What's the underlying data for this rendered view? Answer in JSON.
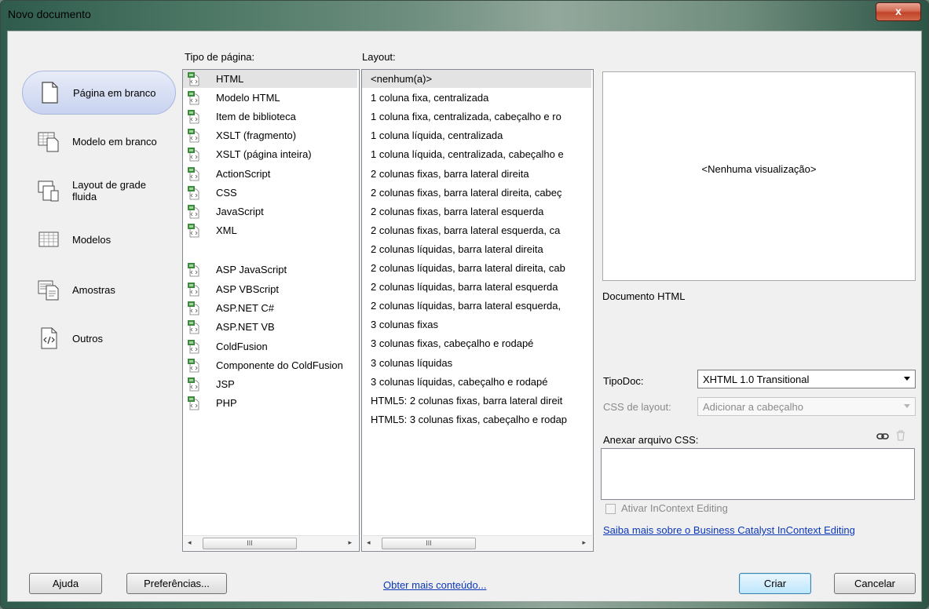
{
  "window": {
    "title": "Novo documento",
    "close_label": "x"
  },
  "nav": [
    {
      "label": "Página em branco",
      "icon": "blank-page-icon",
      "selected": true
    },
    {
      "label": "Modelo em branco",
      "icon": "blank-template-icon"
    },
    {
      "label": "Layout de grade fluida",
      "icon": "fluid-grid-icon"
    },
    {
      "label": "Modelos",
      "icon": "templates-icon"
    },
    {
      "label": "Amostras",
      "icon": "samples-icon"
    },
    {
      "label": "Outros",
      "icon": "code-file-icon"
    }
  ],
  "page_type": {
    "header": "Tipo de página:",
    "items": [
      "HTML",
      "Modelo HTML",
      "Item de biblioteca",
      "XSLT (fragmento)",
      "XSLT (página inteira)",
      "ActionScript",
      "CSS",
      "JavaScript",
      "XML",
      "ASP JavaScript",
      "ASP VBScript",
      "ASP.NET C#",
      "ASP.NET VB",
      "ColdFusion",
      "Componente do ColdFusion",
      "JSP",
      "PHP"
    ],
    "selected": "HTML"
  },
  "layout": {
    "header": "Layout:",
    "items": [
      "<nenhum(a)>",
      "1 coluna fixa, centralizada",
      "1 coluna fixa, centralizada, cabeçalho e ro",
      "1 coluna líquida, centralizada",
      "1 coluna líquida, centralizada, cabeçalho e",
      "2 colunas fixas, barra lateral direita",
      "2 colunas fixas, barra lateral direita, cabeç",
      "2 colunas fixas, barra lateral esquerda",
      "2 colunas fixas, barra lateral esquerda, ca",
      "2 colunas líquidas, barra lateral direita",
      "2 colunas líquidas, barra lateral direita, cab",
      "2 colunas líquidas, barra lateral esquerda",
      "2 colunas líquidas, barra lateral esquerda,",
      "3 colunas fixas",
      "3 colunas fixas, cabeçalho e rodapé",
      "3 colunas líquidas",
      "3 colunas líquidas, cabeçalho e rodapé",
      "HTML5: 2 colunas fixas, barra lateral direit",
      "HTML5: 3 colunas fixas, cabeçalho e rodap"
    ],
    "selected": "<nenhum(a)>"
  },
  "scrollbar": {
    "left_arrow": "◂",
    "right_arrow": "▸",
    "grip": "III"
  },
  "preview": {
    "text": "<Nenhuma visualização>",
    "description": "Documento HTML"
  },
  "doctype": {
    "label": "TipoDoc:",
    "value": "XHTML 1.0 Transitional"
  },
  "layout_css": {
    "label": "CSS de layout:",
    "value": "Adicionar a cabeçalho"
  },
  "attach_css": {
    "label": "Anexar arquivo CSS:"
  },
  "incontext": {
    "label": "Ativar InContext Editing",
    "checked": false
  },
  "links": {
    "learn_more": "Saiba mais sobre o Business Catalyst InContext Editing",
    "more_content": "Obter mais conteúdo..."
  },
  "buttons": {
    "help": "Ajuda",
    "preferences": "Preferências...",
    "create": "Criar",
    "cancel": "Cancelar"
  },
  "colors": {
    "selection": "#c8d3f0",
    "link": "#0b37b8",
    "default_button": "#bde6fd"
  }
}
